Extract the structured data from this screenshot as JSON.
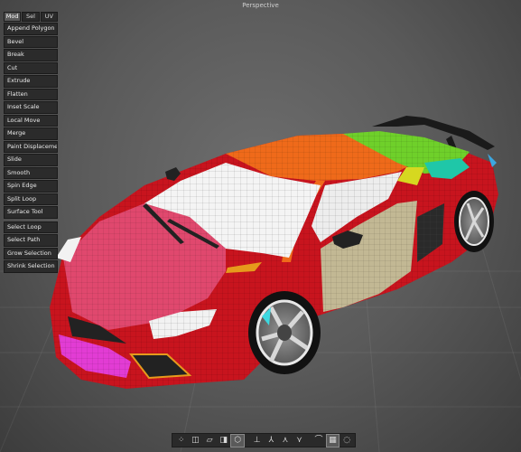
{
  "viewport": {
    "title": "Perspective"
  },
  "tabs": [
    {
      "label": "Mod",
      "active": true
    },
    {
      "label": "Sel",
      "active": false
    },
    {
      "label": "UV",
      "active": false
    }
  ],
  "tools": [
    "Append Polygon",
    "Bevel",
    "Break",
    "Cut",
    "Extrude",
    "Flatten",
    "Inset Scale",
    "Local Move",
    "Merge",
    "Paint Displacement",
    "Slide",
    "Smooth",
    "Spin Edge",
    "Split Loop",
    "Surface Tool"
  ],
  "selection_tools": [
    "Select Loop",
    "Select Path",
    "Grow Selection",
    "Shrink Selection"
  ],
  "bottom_toolbar": {
    "icons": [
      "vertex-mode-icon",
      "edge-mode-icon",
      "face-mode-icon",
      "object-mode-icon",
      "uv-mode-icon",
      "move-gizmo-icon",
      "rotate-gizmo-icon",
      "scale-gizmo-icon",
      "universal-gizmo-icon",
      "soft-select-icon",
      "box-select-icon",
      "lasso-select-icon"
    ]
  }
}
